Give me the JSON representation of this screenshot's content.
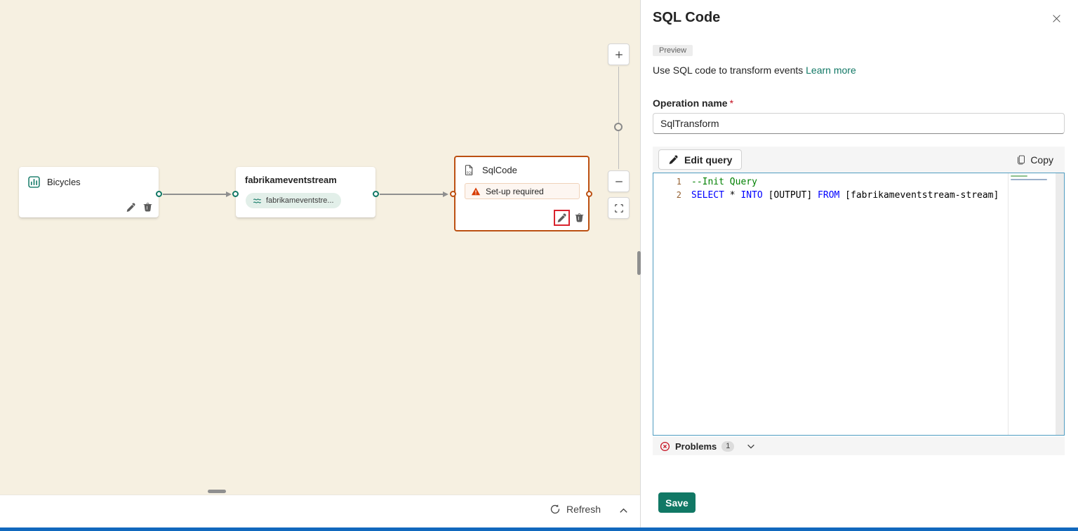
{
  "colors": {
    "accent_teal": "#117865",
    "node_error_border": "#bc5012",
    "warning_orange": "#d83b01",
    "highlight_red": "#d9232e",
    "link": "#117865",
    "save_button_bg": "#117865",
    "code_keyword": "#0000ff",
    "code_comment": "#008000",
    "canvas_bg": "#f6f0e1",
    "bottom_strip_blue": "#1168bd"
  },
  "canvas": {
    "nodes": {
      "bicycles": {
        "title": "Bicycles"
      },
      "eventstream": {
        "title": "fabrikameventstream",
        "badge": "fabrikameventstre..."
      },
      "sqlcode": {
        "title": "SqlCode",
        "warning": "Set-up required"
      }
    },
    "footer": {
      "refresh_label": "Refresh"
    }
  },
  "panel": {
    "title": "SQL Code",
    "preview_badge": "Preview",
    "description": "Use SQL code to transform events ",
    "learn_more_label": "Learn more",
    "operation_name": {
      "label": "Operation name",
      "required_mark": "*",
      "value": "SqlTransform"
    },
    "toolbar": {
      "edit_query_label": "Edit query",
      "copy_label": "Copy"
    },
    "problems": {
      "label": "Problems",
      "count": "1"
    },
    "save_label": "Save"
  },
  "code": {
    "lines": [
      {
        "number": "1",
        "tokens": [
          {
            "text": "--Init Query",
            "type": "comment"
          }
        ]
      },
      {
        "number": "2",
        "tokens": [
          {
            "text": "SELECT",
            "type": "keyword"
          },
          {
            "text": " * ",
            "type": "plain"
          },
          {
            "text": "INTO",
            "type": "keyword"
          },
          {
            "text": " [OUTPUT] ",
            "type": "plain"
          },
          {
            "text": "FROM",
            "type": "keyword"
          },
          {
            "text": " [fabrikameventstream-stream]",
            "type": "plain"
          }
        ]
      }
    ]
  }
}
